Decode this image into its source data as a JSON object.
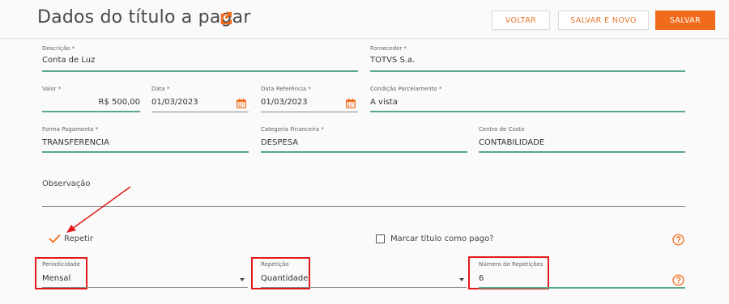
{
  "header": {
    "title": "Dados do título a pagar",
    "icon": "external-link-icon",
    "back_label": "VOLTAR",
    "save_new_label": "SALVAR E NOVO",
    "save_label": "SALVAR"
  },
  "colors": {
    "accent": "#f26b1d",
    "underline": "#5aa88b",
    "highlight_box": "#e11b1b"
  },
  "form": {
    "descricao": {
      "label": "Descrição *",
      "value": "Conta de Luz"
    },
    "fornecedor": {
      "label": "Fornecedor *",
      "value": "TOTVS S.a."
    },
    "valor": {
      "label": "Valor *",
      "value": "R$ 500,00"
    },
    "data": {
      "label": "Data *",
      "value": "01/03/2023"
    },
    "data_referencia": {
      "label": "Data Referência *",
      "value": "01/03/2023"
    },
    "condicao_parcelamento": {
      "label": "Condição Parcelamento *",
      "value": "A vista"
    },
    "forma_pagamento": {
      "label": "Forma Pagamento *",
      "value": "TRANSFERENCIA"
    },
    "categoria_financeira": {
      "label": "Categoria Financeira *",
      "value": "DESPESA"
    },
    "centro_custo": {
      "label": "Centro de Custo",
      "value": "CONTABILIDADE"
    },
    "observacao": {
      "placeholder": "Observação"
    },
    "repetir": {
      "label": "Repetir",
      "checked": true
    },
    "marcar_pago": {
      "label": "Marcar título como pago?",
      "checked": false
    },
    "periodicidade": {
      "label": "Periodicidade",
      "value": "Mensal"
    },
    "repeticao": {
      "label": "Repetição",
      "value": "Quantidade"
    },
    "numero_repeticoes": {
      "label": "Número de Repetições",
      "value": "6"
    }
  }
}
